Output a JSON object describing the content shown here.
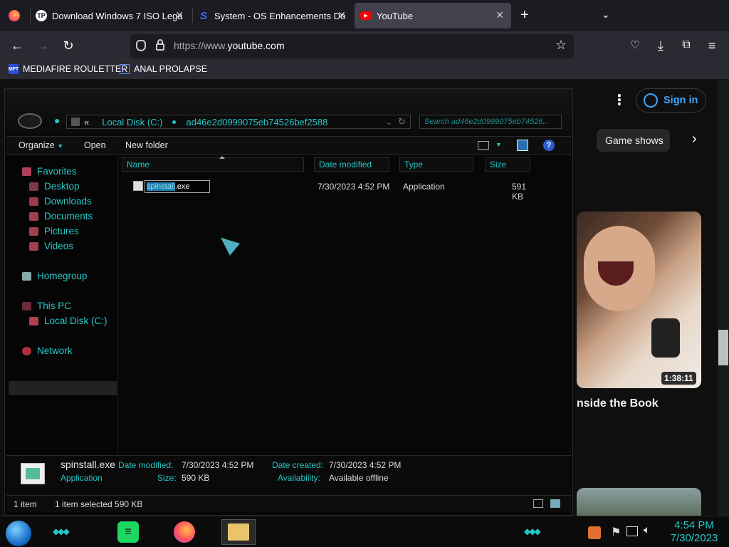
{
  "browser": {
    "tabs": [
      {
        "title": "Download Windows 7 ISO Lega",
        "icon": "tp-icon"
      },
      {
        "title": "System - OS Enhancements Do",
        "icon": "s-icon"
      },
      {
        "title": "YouTube",
        "icon": "youtube-icon"
      }
    ],
    "url_prefix": "https://www.",
    "url_domain": "youtube.com",
    "bookmarks": [
      {
        "label": "MEDIAFIRE ROULETTER",
        "icon_text": "MFT"
      },
      {
        "label": "ANAL PROLAPSE"
      }
    ]
  },
  "youtube": {
    "sign_in": "Sign in",
    "chip": "Game shows",
    "duration": "1:38:11",
    "video_title": "nside the Book"
  },
  "explorer": {
    "address": {
      "root": "Local Disk (C:)",
      "folder": "ad46e2d0999075eb74526bef2588",
      "prefix": "«"
    },
    "search_placeholder": "Search ad46e2d0999075eb74526...",
    "commands": {
      "organize": "Organize",
      "open": "Open",
      "new_folder": "New folder"
    },
    "nav": {
      "favorites": "Favorites",
      "desktop": "Desktop",
      "downloads": "Downloads",
      "documents": "Documents",
      "pictures": "Pictures",
      "videos": "Videos",
      "homegroup": "Homegroup",
      "this_pc": "This PC",
      "local_disk": "Local Disk (C:)",
      "network": "Network"
    },
    "columns": {
      "name": "Name",
      "date": "Date modified",
      "type": "Type",
      "size": "Size"
    },
    "file": {
      "name_selected": "spinstall",
      "name_ext": ".exe",
      "date": "7/30/2023 4:52 PM",
      "type": "Application",
      "size": "591 KB"
    },
    "details": {
      "filename": "spinstall.exe",
      "filetype": "Application",
      "date_modified_label": "Date modified:",
      "date_modified": "7/30/2023 4:52 PM",
      "size_label": "Size:",
      "size": "590 KB",
      "date_created_label": "Date created:",
      "date_created": "7/30/2023 4:52 PM",
      "availability_label": "Availability:",
      "availability": "Available offline"
    },
    "status": {
      "items": "1 item",
      "selected": "1 item selected  590 KB"
    }
  },
  "taskbar": {
    "time": "4:54 PM",
    "date": "7/30/2023"
  },
  "colors": {
    "accent": "#27c7c7",
    "yt_blue": "#3ea6ff",
    "bg": "#0f0f0f"
  }
}
